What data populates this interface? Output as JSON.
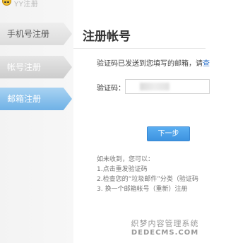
{
  "app": {
    "title": "YY注册"
  },
  "sidebar": {
    "items": [
      {
        "label": "手机号注册"
      },
      {
        "label": "帐号注册"
      },
      {
        "label": "邮箱注册"
      }
    ]
  },
  "main": {
    "title": "注册帐号",
    "info_text": "验证码已发送到您填写的邮箱，请",
    "info_link": "查",
    "code_label": "验证码：",
    "next_button": "下一步",
    "help": {
      "intro": "如未收到，您可以：",
      "lines": [
        "1.点击重发验证码",
        "2.检查您的“垃圾邮件”分类（验证码",
        "3. 换一个邮箱帐号（重新）注册"
      ]
    }
  },
  "watermark": {
    "line1": "织梦内容管理系统",
    "line2": "DEDECMS.COM"
  },
  "colors": {
    "active_tab": "#6fb1e6",
    "button": "#3d93e0",
    "link": "#2a6fc9"
  }
}
